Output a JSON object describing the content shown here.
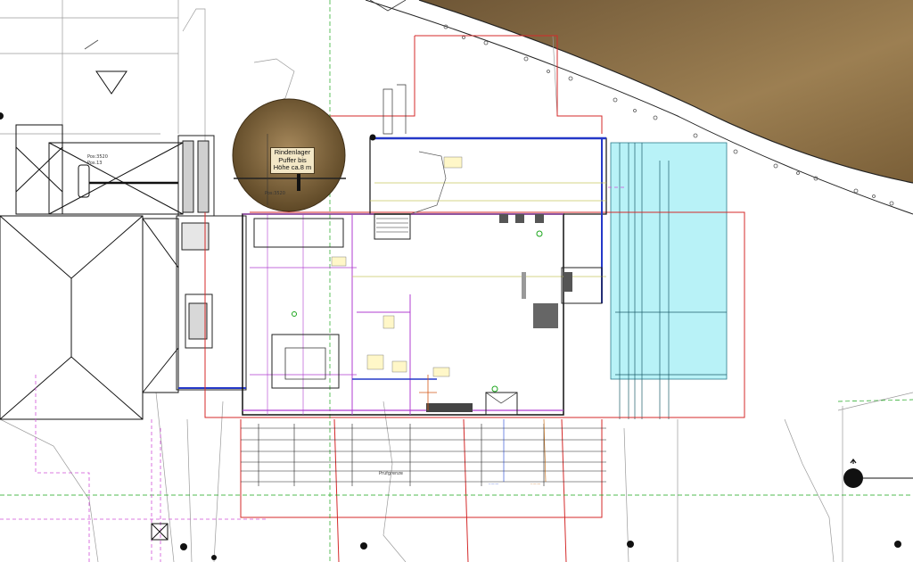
{
  "drawing": {
    "callout_lines": [
      "Rindenlager",
      "Puffer bis",
      "Höhe ca.8 m"
    ],
    "labels": {
      "pos_top_left": [
        "Pos:3520",
        "Pos.13"
      ],
      "pos_in_circle": "Pos:3520",
      "bottom_label": "Prüfgrenze"
    },
    "colors": {
      "terrain": "#8c6f45",
      "water_area": "#b8f2f7",
      "boundary_red": "#d42a2a",
      "wall_magenta": "#b03cd0",
      "grid_green": "#1aa51a",
      "wall_blue": "#2438c8"
    }
  }
}
